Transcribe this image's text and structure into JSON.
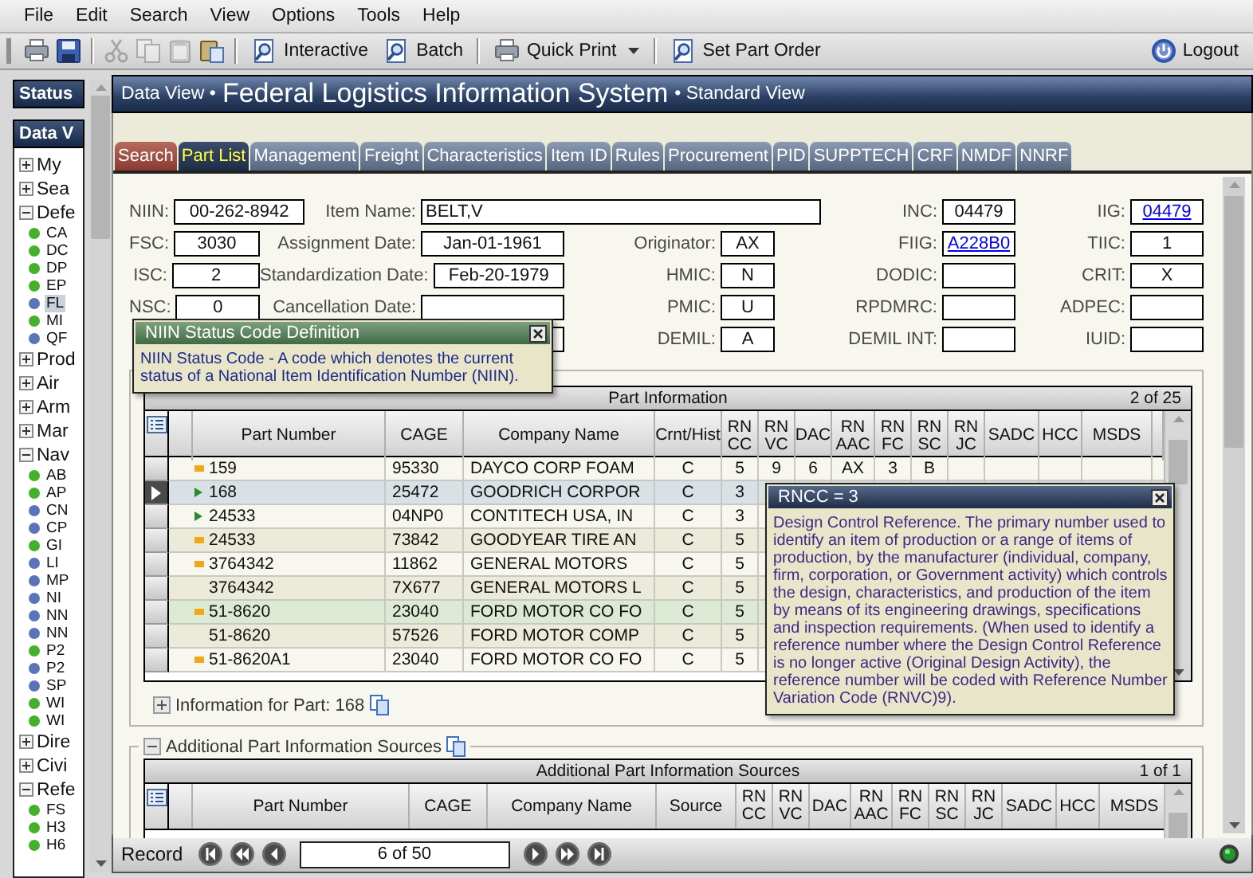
{
  "menu": [
    "File",
    "Edit",
    "Search",
    "View",
    "Options",
    "Tools",
    "Help"
  ],
  "toolbar": [
    {
      "kind": "print",
      "disabled": false
    },
    {
      "kind": "save",
      "disabled": false
    },
    {
      "kind": "separator"
    },
    {
      "kind": "cut",
      "disabled": true
    },
    {
      "kind": "copy",
      "disabled": true
    },
    {
      "kind": "paste",
      "disabled": true
    },
    {
      "kind": "paste-special",
      "disabled": false
    },
    {
      "kind": "separator"
    },
    {
      "kind": "search-doc",
      "label": "Interactive",
      "disabled": false
    },
    {
      "kind": "search-doc",
      "label": "Batch",
      "disabled": false
    },
    {
      "kind": "separator"
    },
    {
      "kind": "print",
      "label": "Quick Print",
      "dropdown": true,
      "disabled": false
    },
    {
      "kind": "separator"
    },
    {
      "kind": "search-doc",
      "label": "Set Part Order",
      "disabled": false
    }
  ],
  "logout": "Logout",
  "sidebar": {
    "status_title": "Status",
    "data_title": "Data V",
    "tree": [
      {
        "label": "My",
        "expanded": false
      },
      {
        "label": "Sea",
        "expanded": false
      },
      {
        "label": "Defe",
        "expanded": true,
        "children": [
          {
            "label": "CA",
            "color": "#44b02c",
            "selected": false
          },
          {
            "label": "DC",
            "color": "#44b02c",
            "selected": false
          },
          {
            "label": "DP",
            "color": "#44b02c",
            "selected": false
          },
          {
            "label": "EP",
            "color": "#44b02c",
            "selected": false
          },
          {
            "label": "FL",
            "color": "#5b73b8",
            "selected": true
          },
          {
            "label": "MI",
            "color": "#44b02c",
            "selected": false
          },
          {
            "label": "QF",
            "color": "#5b73b8",
            "selected": false
          }
        ]
      },
      {
        "label": "Prod",
        "expanded": false
      },
      {
        "label": "Air",
        "expanded": false
      },
      {
        "label": "Arm",
        "expanded": false
      },
      {
        "label": "Mar",
        "expanded": false
      },
      {
        "label": "Nav",
        "expanded": true,
        "children": [
          {
            "label": "AB",
            "color": "#44b02c",
            "selected": false
          },
          {
            "label": "AP",
            "color": "#44b02c",
            "selected": false
          },
          {
            "label": "CN",
            "color": "#5b73b8",
            "selected": false
          },
          {
            "label": "CP",
            "color": "#5b73b8",
            "selected": false
          },
          {
            "label": "GI",
            "color": "#44b02c",
            "selected": false
          },
          {
            "label": "LI",
            "color": "#5b73b8",
            "selected": false
          },
          {
            "label": "MP",
            "color": "#5b73b8",
            "selected": false
          },
          {
            "label": "NI",
            "color": "#5b73b8",
            "selected": false
          },
          {
            "label": "NN",
            "color": "#5b73b8",
            "selected": false
          },
          {
            "label": "NN",
            "color": "#5b73b8",
            "selected": false
          },
          {
            "label": "P2",
            "color": "#44b02c",
            "selected": false
          },
          {
            "label": "P2",
            "color": "#5b73b8",
            "selected": false
          },
          {
            "label": "SP",
            "color": "#5b73b8",
            "selected": false
          },
          {
            "label": "WI",
            "color": "#44b02c",
            "selected": false
          },
          {
            "label": "WI",
            "color": "#44b02c",
            "selected": false
          }
        ]
      },
      {
        "label": "Dire",
        "expanded": false
      },
      {
        "label": "Civi",
        "expanded": false
      },
      {
        "label": "Refe",
        "expanded": true,
        "children": [
          {
            "label": "FS",
            "color": "#44b02c",
            "selected": false
          },
          {
            "label": "H3",
            "color": "#44b02c",
            "selected": false
          },
          {
            "label": "H6",
            "color": "#44b02c",
            "selected": false
          }
        ]
      }
    ]
  },
  "header": {
    "left": "Data View •",
    "title": "Federal Logistics Information System",
    "right": "• Standard View"
  },
  "tabs": [
    {
      "label": "Search",
      "kind": "action",
      "selected": false
    },
    {
      "label": "Part List",
      "kind": "page",
      "selected": true
    },
    {
      "label": "Management",
      "kind": "page",
      "selected": false
    },
    {
      "label": "Freight",
      "kind": "page",
      "selected": false
    },
    {
      "label": "Characteristics",
      "kind": "page",
      "selected": false
    },
    {
      "label": "Item ID",
      "kind": "page",
      "selected": false
    },
    {
      "label": "Rules",
      "kind": "page",
      "selected": false
    },
    {
      "label": "Procurement",
      "kind": "page",
      "selected": false
    },
    {
      "label": "PID",
      "kind": "page",
      "selected": false
    },
    {
      "label": "SUPPTECH",
      "kind": "page",
      "selected": false
    },
    {
      "label": "CRF",
      "kind": "page",
      "selected": false
    },
    {
      "label": "NMDF",
      "kind": "page",
      "selected": false
    },
    {
      "label": "NNRF",
      "kind": "page",
      "selected": false
    }
  ],
  "form": [
    [
      {
        "kind": "field",
        "label": "NIIN:",
        "value": "00-262-8942",
        "link": false
      },
      {
        "kind": "field",
        "label": "Item Name:",
        "value": "BELT,V",
        "link": false
      },
      {
        "kind": "field",
        "label": "INC:",
        "value": "04479",
        "link": false
      },
      {
        "kind": "field",
        "label": "IIG:",
        "value": "04479",
        "link": true
      }
    ],
    [
      {
        "kind": "field",
        "label": "FSC:",
        "value": "3030",
        "link": false
      },
      {
        "kind": "field",
        "label": "Assignment Date:",
        "value": "Jan-01-1961",
        "link": false
      },
      {
        "kind": "field",
        "label": "Originator:",
        "value": "AX",
        "link": false
      },
      {
        "kind": "field",
        "label": "FIIG:",
        "value": "A228B0",
        "link": true
      },
      {
        "kind": "field",
        "label": "TIIC:",
        "value": "1",
        "link": false
      }
    ],
    [
      {
        "kind": "field",
        "label": "ISC:",
        "value": "2",
        "link": false
      },
      {
        "kind": "field",
        "label": "Standardization Date:",
        "value": "Feb-20-1979",
        "link": false
      },
      {
        "kind": "field",
        "label": "HMIC:",
        "value": "N",
        "link": false
      },
      {
        "kind": "field",
        "label": "DODIC:"
      },
      {
        "kind": "field",
        "label": "CRIT:",
        "value": "X",
        "link": false
      }
    ],
    [
      {
        "kind": "field",
        "label": "NSC:",
        "value": "0",
        "link": false
      },
      {
        "kind": "field",
        "label": "Cancellation Date:"
      },
      {
        "kind": "field",
        "label": "PMIC:",
        "value": "U",
        "link": false
      },
      {
        "kind": "field",
        "label": "RPDMRC:"
      },
      {
        "kind": "field",
        "label": "ADPEC:"
      }
    ],
    [
      {
        "kind": "gap"
      },
      {
        "kind": "field"
      },
      {
        "kind": "field",
        "label": "DEMIL:",
        "value": "A",
        "link": false
      },
      {
        "kind": "field",
        "label": "DEMIL INT:"
      },
      {
        "kind": "field",
        "label": "IUID:"
      }
    ]
  ],
  "part_info": {
    "title": "Part Information",
    "count": "2 of 25",
    "columns": [
      "Part Number",
      "CAGE",
      "Company Name",
      "Crnt/Hist",
      "RN CC",
      "RN VC",
      "DAC",
      "RN AAC",
      "RN FC",
      "RN SC",
      "RN JC",
      "SADC",
      "HCC",
      "MSDS"
    ],
    "rows": [
      {
        "selected": false,
        "highlight": false,
        "kind": "square",
        "cells": [
          "159",
          "95330",
          "DAYCO CORP FOAM",
          "C",
          "5",
          "9",
          "6",
          "AX",
          "3",
          "B"
        ]
      },
      {
        "selected": true,
        "highlight": false,
        "kind": "triangle",
        "cells": [
          "168",
          "25472",
          "GOODRICH CORPOR",
          "C",
          "3"
        ]
      },
      {
        "selected": false,
        "highlight": false,
        "kind": "triangle",
        "cells": [
          "24533",
          "04NP0",
          "CONTITECH USA, IN",
          "C",
          "3"
        ]
      },
      {
        "selected": false,
        "highlight": false,
        "kind": "square",
        "cells": [
          "24533",
          "73842",
          "GOODYEAR TIRE AN",
          "C",
          "5"
        ]
      },
      {
        "selected": false,
        "highlight": false,
        "kind": "square",
        "cells": [
          "3764342",
          "11862",
          "GENERAL MOTORS",
          "C",
          "5"
        ]
      },
      {
        "selected": false,
        "highlight": false,
        "kind": "plain",
        "cells": [
          "3764342",
          "7X677",
          "GENERAL MOTORS L",
          "C",
          "5"
        ]
      },
      {
        "selected": false,
        "highlight": true,
        "kind": "square",
        "cells": [
          "51-8620",
          "23040",
          "FORD MOTOR CO FO",
          "C",
          "5"
        ]
      },
      {
        "selected": false,
        "highlight": false,
        "kind": "plain",
        "cells": [
          "51-8620",
          "57526",
          "FORD MOTOR COMP",
          "C",
          "5"
        ]
      },
      {
        "selected": false,
        "highlight": false,
        "kind": "square",
        "cells": [
          "51-8620A1",
          "23040",
          "FORD MOTOR CO FO",
          "C",
          "5"
        ]
      }
    ],
    "info": "Information for Part: 168",
    "info_expanded": false
  },
  "additional_sources": {
    "legend": "Additional Part Information Sources",
    "expanded": true,
    "title": "Additional Part Information Sources",
    "count": "1 of 1",
    "columns": [
      "Part Number",
      "CAGE",
      "Company Name",
      "Source",
      "RN CC",
      "RN VC",
      "DAC",
      "RN AAC",
      "RN FC",
      "RN SC",
      "RN JC",
      "SADC",
      "HCC",
      "MSDS"
    ]
  },
  "tooltips": [
    {
      "kind": "definition",
      "title": "NIIN Status Code Definition",
      "text": "NIIN Status Code - A code which denotes the current status of a National Item Identification Number (NIIN)."
    },
    {
      "kind": "code",
      "title": "RNCC = 3",
      "text": "Design Control Reference. The primary number used to identify an item of production or a range of items of production, by the manufacturer (individual, company, firm, corporation, or Government activity) which controls the design, characteristics, and production of the item by means of its engineering drawings, specifications and inspection requirements. (When used to identify a reference number where the Design Control Reference is no longer active (Original Design Activity), the reference number will be coded with Reference Number Variation Code (RNVC)9)."
    }
  ],
  "record": {
    "label": "Record",
    "value": "6 of 50"
  }
}
